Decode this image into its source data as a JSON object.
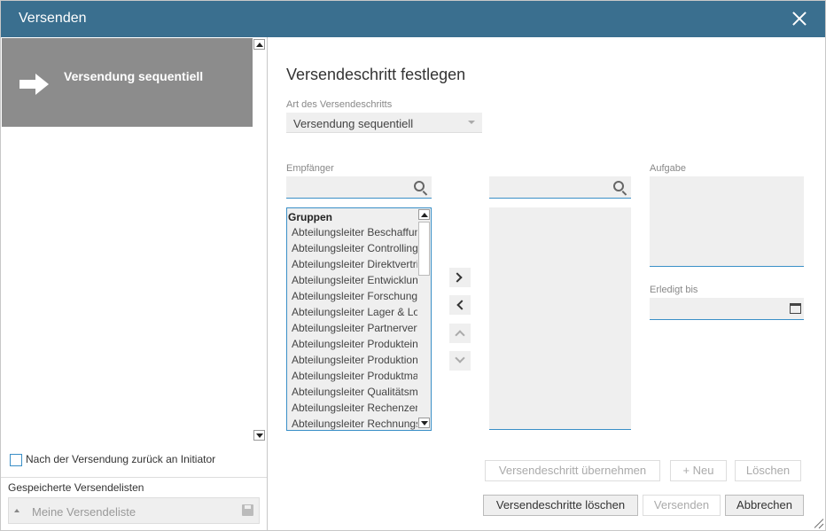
{
  "window": {
    "title": "Versenden"
  },
  "sidebar": {
    "steps": [
      {
        "label": "Versendung sequentiell",
        "icon": "arrow-right-icon"
      }
    ],
    "return_checkbox": {
      "label": "Nach der Versendung zurück an Initiator",
      "checked": false
    },
    "saved_lists": {
      "title": "Gespeicherte Versendelisten",
      "selected": "Meine Versendeliste"
    }
  },
  "main": {
    "heading": "Versendeschritt festlegen",
    "step_type": {
      "label": "Art des Versendeschritts",
      "value": "Versendung sequentiell"
    },
    "recipients": {
      "label": "Empfänger",
      "search_value": "",
      "group_header": "Gruppen",
      "items": [
        "Abteilungsleiter Beschaffung",
        "Abteilungsleiter Controlling",
        "Abteilungsleiter Direktvertrieb",
        "Abteilungsleiter Entwicklung",
        "Abteilungsleiter Forschung",
        "Abteilungsleiter Lager & Logistik",
        "Abteilungsleiter Partnervertrieb",
        "Abteilungsleiter Produkteinführung",
        "Abteilungsleiter Produktion",
        "Abteilungsleiter Produktmanagement",
        "Abteilungsleiter Qualitätsmanagement",
        "Abteilungsleiter Rechenzentrum",
        "Abteilungsleiter Rechnungswesen"
      ]
    },
    "selected_search_value": "",
    "task": {
      "label": "Aufgabe",
      "value": ""
    },
    "due": {
      "label": "Erledigt bis",
      "value": ""
    },
    "buttons": {
      "apply_step": "Versendeschritt übernehmen",
      "new": "+ Neu",
      "delete": "Löschen",
      "delete_steps": "Versendeschritte löschen",
      "send": "Versenden",
      "cancel": "Abbrechen"
    }
  },
  "colors": {
    "titlebar": "#3a6f8f",
    "accent": "#3a8fc7",
    "selected_step": "#8c8c8c"
  }
}
